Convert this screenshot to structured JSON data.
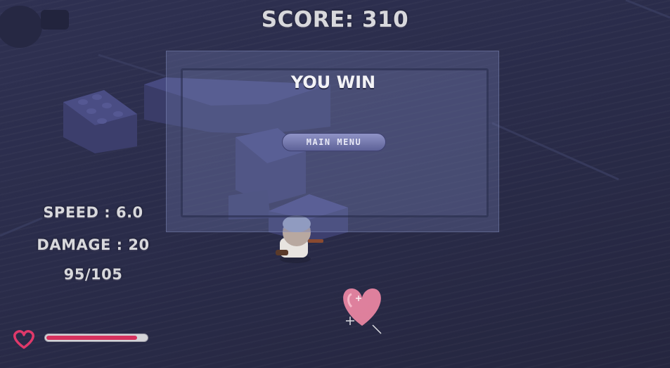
{
  "hud": {
    "score_text": "SCORE: 310",
    "speed_text": "SPEED : 6.0",
    "damage_text": "DAMAGE : 20",
    "hp_text": "95/105",
    "health_fraction": 0.905
  },
  "dialog": {
    "title": "YOU WIN",
    "main_menu_label": "MAIN MENU"
  },
  "icons": {
    "health": "heart-outline-icon",
    "pickup": "heart-pickup"
  },
  "colors": {
    "health_fill": "#d6315e",
    "heart_outline": "#e0396a",
    "pickup_heart": "#f28aa6",
    "background": "#2a2c4a"
  }
}
